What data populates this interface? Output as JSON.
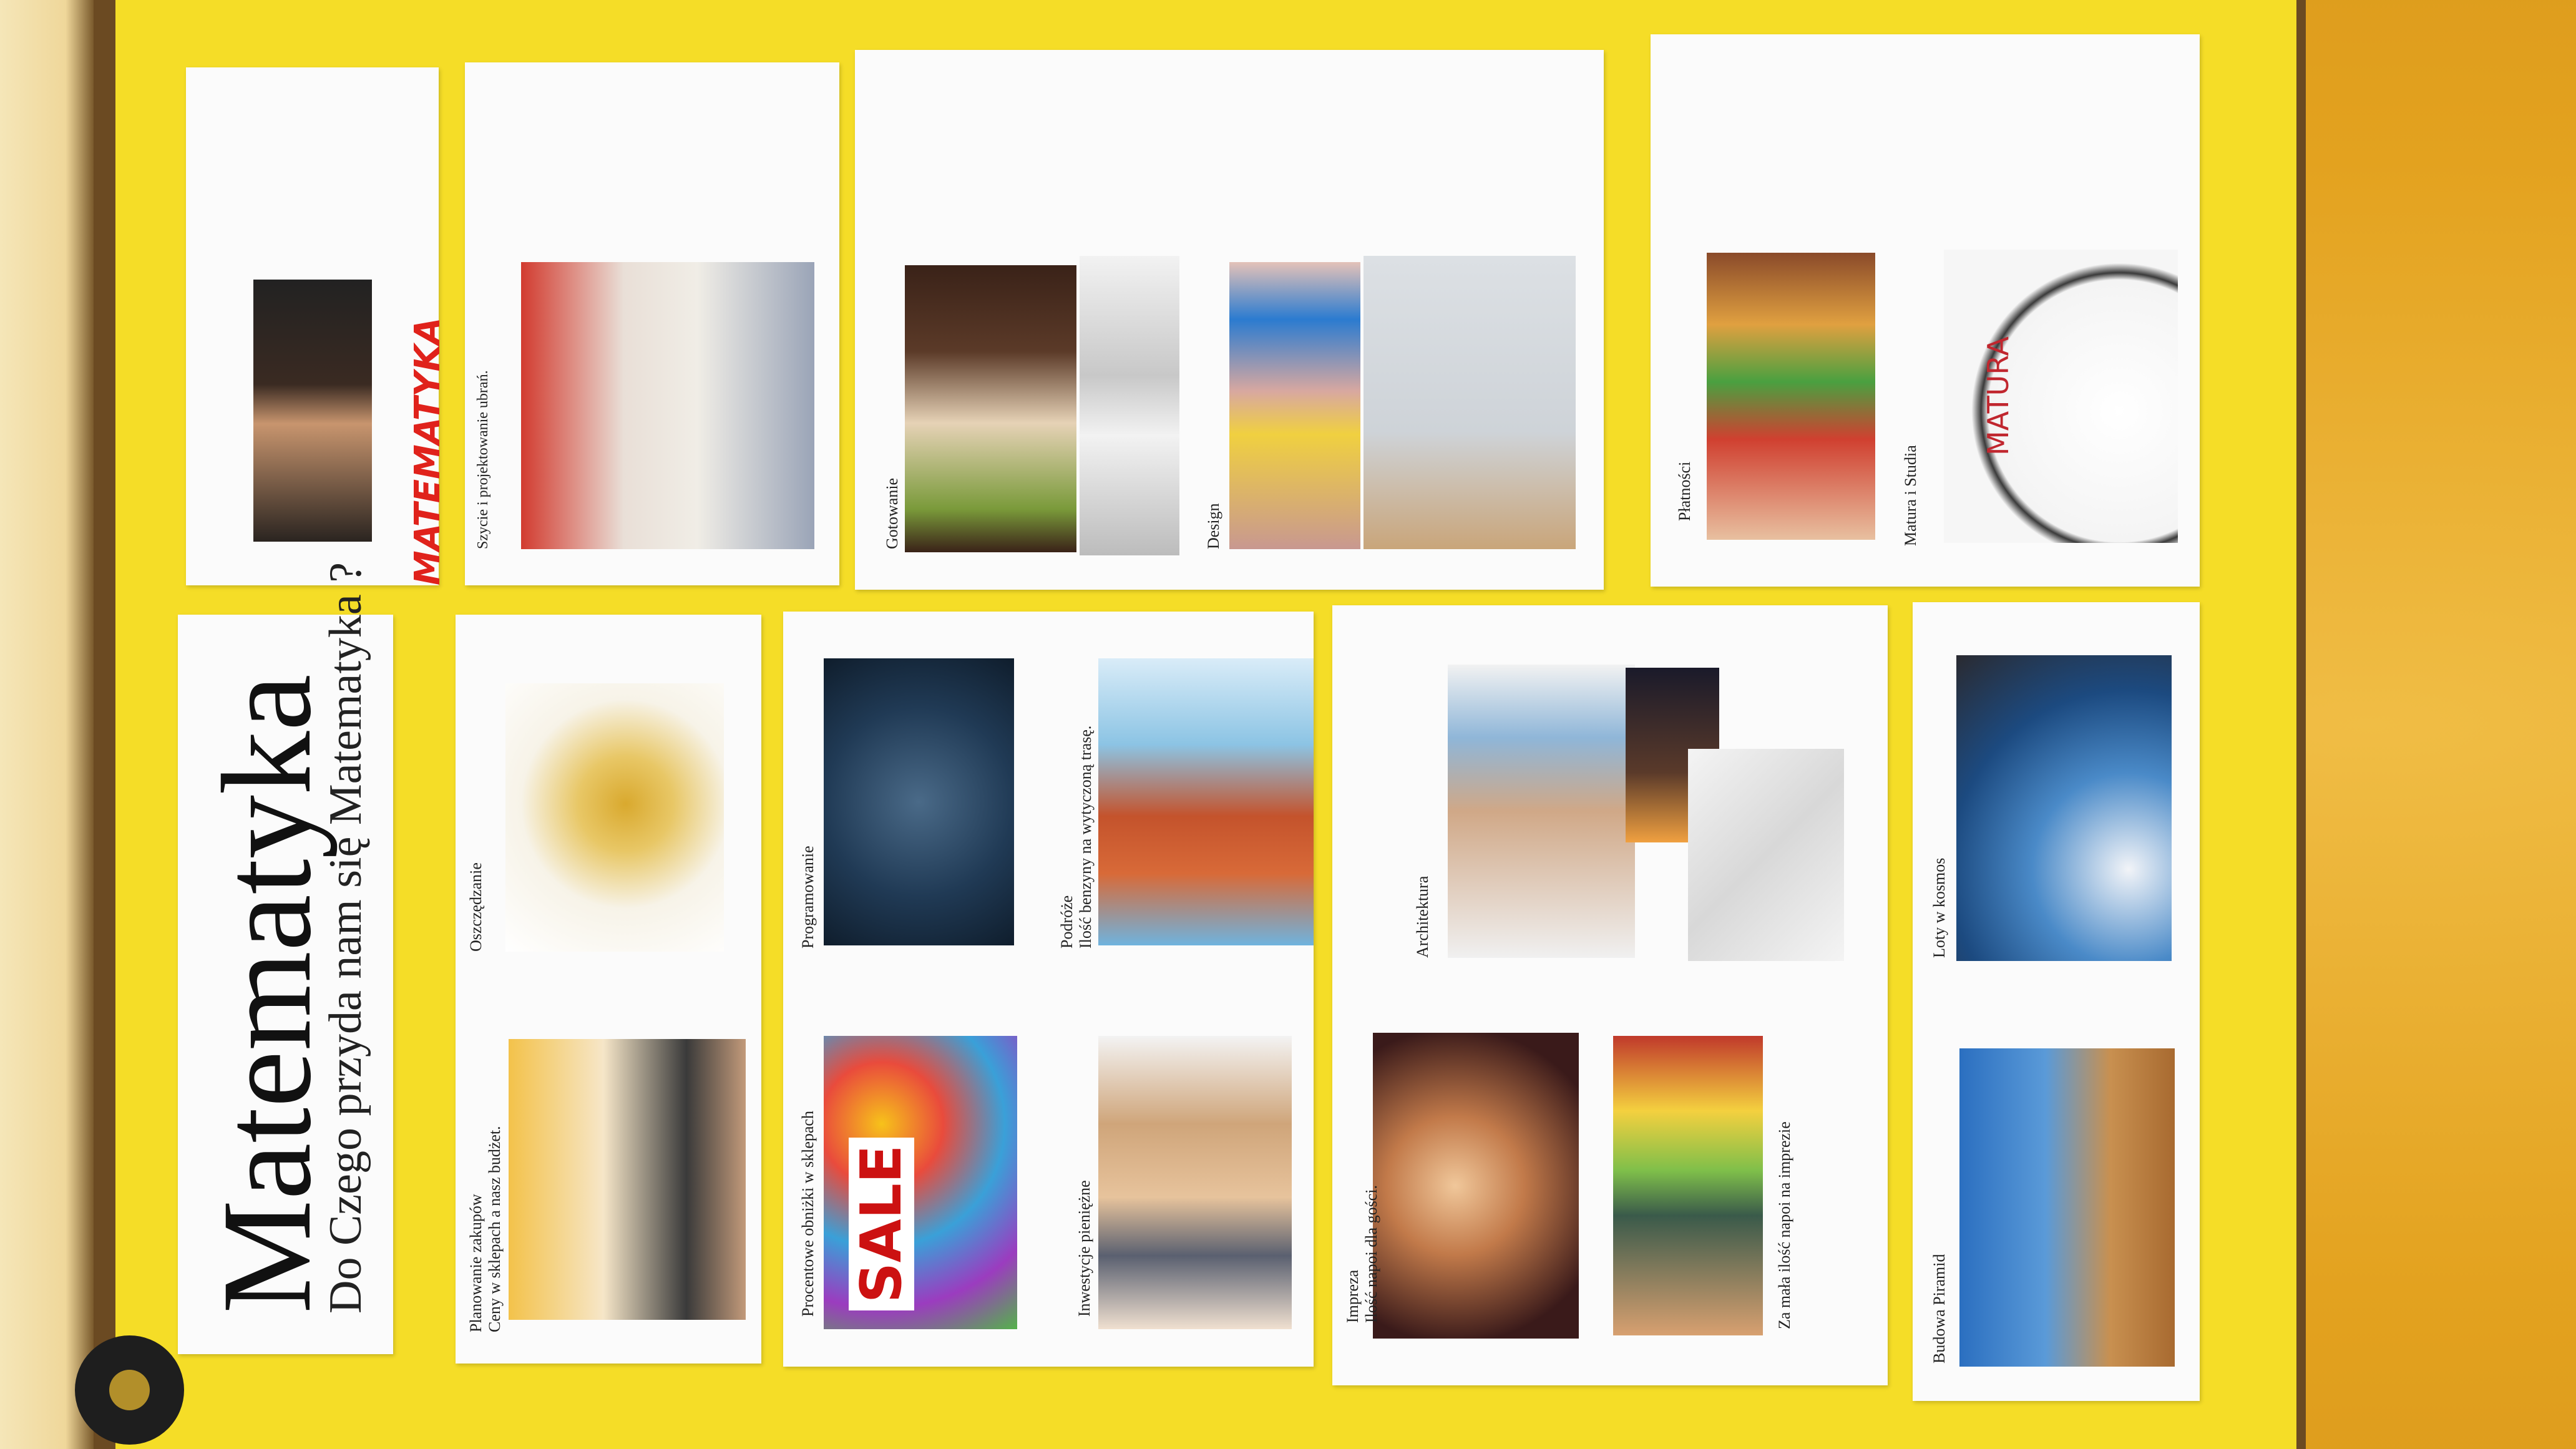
{
  "title_card": {
    "title": "Matematyka",
    "subtitle": "Do Czego przyda nam się Matematyka ?"
  },
  "logo_card": {
    "logo_text": "MATEMATYKA"
  },
  "cards": {
    "zakupy": {
      "label": "Planowanie zakupów",
      "sublabel": "Ceny w sklepach a nasz budżet."
    },
    "oszczedzanie": {
      "label": "Oszczędzanie"
    },
    "szycie": {
      "label": "Szycie i projektowanie ubrań."
    },
    "obnizki": {
      "label": "Procentowe obniżki w sklepach",
      "sale_text": "SALE"
    },
    "programowanie": {
      "label": "Programowanie"
    },
    "inwestycje": {
      "label": "Inwestycje pieniężne"
    },
    "podroze": {
      "label": "Podróże",
      "sublabel": "Ilość benzyny na wytyczoną trasę."
    },
    "gotowanie": {
      "label": "Gotowanie"
    },
    "design": {
      "label": "Design"
    },
    "impreza": {
      "label": "Impreza",
      "sublabel": "Ilość napoi dla gości."
    },
    "napoje": {
      "label": "Za mała ilość napoi na imprezie"
    },
    "architektura": {
      "label": "Architektura"
    },
    "platnosci": {
      "label": "Płatności"
    },
    "matura": {
      "label": "Matura i Studia",
      "clock_text": "MATURA"
    },
    "piramidy": {
      "label": "Budowa Piramid"
    },
    "kosmos": {
      "label": "Loty w kosmos"
    }
  }
}
